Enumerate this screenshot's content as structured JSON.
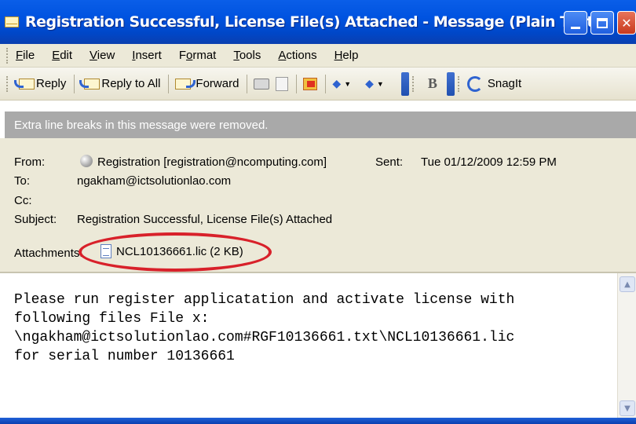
{
  "window": {
    "title": "Registration Successful, License File(s) Attached - Message (Plain Text)"
  },
  "menu": {
    "items": [
      {
        "label": "File",
        "u": "F",
        "rest": "ile"
      },
      {
        "label": "Edit",
        "u": "E",
        "rest": "dit"
      },
      {
        "label": "View",
        "u": "V",
        "rest": "iew"
      },
      {
        "label": "Insert",
        "u": "I",
        "rest": "nsert"
      },
      {
        "label": "Format",
        "pre": "F",
        "u": "o",
        "rest": "rmat"
      },
      {
        "label": "Tools",
        "u": "T",
        "rest": "ools"
      },
      {
        "label": "Actions",
        "u": "A",
        "rest": "ctions"
      },
      {
        "label": "Help",
        "u": "H",
        "rest": "elp"
      }
    ]
  },
  "toolbar": {
    "reply": "Reply",
    "reply_all": "Reply to All",
    "forward": "Forward",
    "bold": "B",
    "snagit": "SnagIt"
  },
  "infobar": {
    "text": "Extra line breaks in this message were removed."
  },
  "header": {
    "from_label": "From:",
    "from_value": "Registration [registration@ncomputing.com]",
    "sent_label": "Sent:",
    "sent_value": "Tue 01/12/2009 12:59 PM",
    "to_label": "To:",
    "to_value": "ngakham@ictsolutionlao.com",
    "cc_label": "Cc:",
    "subject_label": "Subject:",
    "subject_value": "Registration Successful, License File(s) Attached",
    "attachments_label": "Attachments:",
    "attachment_name": "NCL10136661.lic (2 KB)"
  },
  "body": {
    "text": "Please run register applicatation and activate license with\nfollowing files File x:\n\\ngakham@ictsolutionlao.com#RGF10136661.txt\\NCL10136661.lic\nfor serial number 10136661"
  },
  "colors": {
    "titlebar": "#0053e0",
    "highlight_ellipse": "#d8212a",
    "infobar": "#a9a9a9"
  }
}
